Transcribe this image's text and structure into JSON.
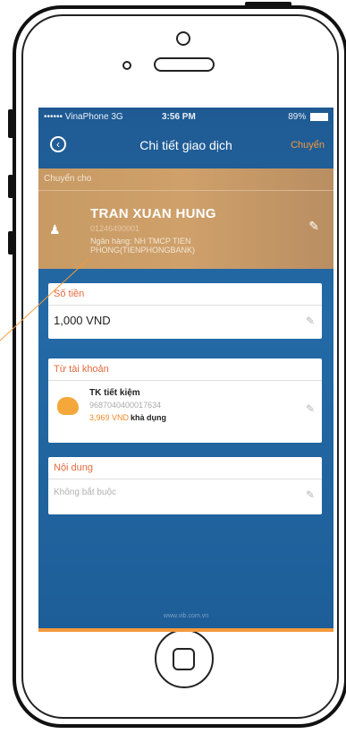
{
  "status": {
    "carrier": "•••••• VinaPhone  3G",
    "time": "3:56 PM",
    "battery": "89%"
  },
  "header": {
    "title": "Chi tiết giao dịch",
    "action": "Chuyển"
  },
  "recipient": {
    "label": "Chuyển cho",
    "name": "TRAN XUAN HUNG",
    "account": "01246490001",
    "bank": "Ngân hàng: NH TMCP TIEN PHONG(TIENPHONGBANK)"
  },
  "amount_card": {
    "title": "Số tiền",
    "value": "1,000  VND"
  },
  "from_card": {
    "title": "Từ tài khoản",
    "account_name": "TK tiết kiệm",
    "account_number": "9687040400017634",
    "balance": "3,969 VND",
    "available": "khả dụng"
  },
  "note_card": {
    "title": "Nội dung",
    "placeholder": "Không bắt buộc"
  },
  "footer": "www.vib.com.vn",
  "colors": {
    "accent": "#f39a3a",
    "title_red": "#e56b3e",
    "screen_blue": "#236aa6",
    "recipient_tan": "#c89a64"
  }
}
